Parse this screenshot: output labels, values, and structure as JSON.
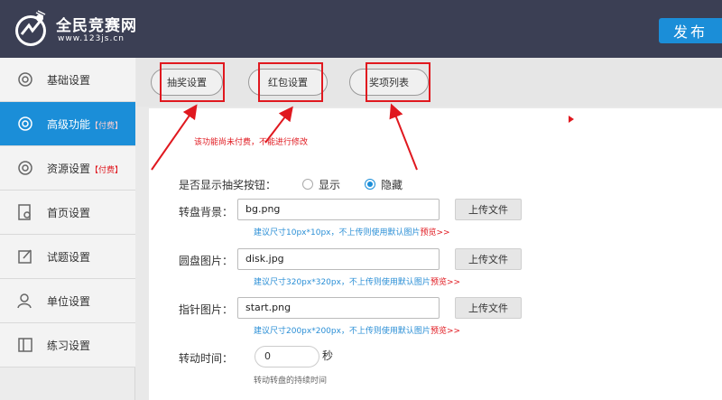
{
  "header": {
    "logo_title": "全民竞赛网",
    "logo_sub": "www.123js.cn",
    "publish_label": "发布"
  },
  "sidebar": {
    "items": [
      {
        "label": "基础设置",
        "badge": "",
        "icon": "gear-icon",
        "active": false
      },
      {
        "label": "高级功能",
        "badge": "【付费】",
        "icon": "gear-icon",
        "active": true
      },
      {
        "label": "资源设置",
        "badge": "【付费】",
        "icon": "gear-icon",
        "active": false
      },
      {
        "label": "首页设置",
        "badge": "",
        "icon": "document-search-icon",
        "active": false
      },
      {
        "label": "试题设置",
        "badge": "",
        "icon": "edit-icon",
        "active": false
      },
      {
        "label": "单位设置",
        "badge": "",
        "icon": "user-icon",
        "active": false
      },
      {
        "label": "练习设置",
        "badge": "",
        "icon": "book-icon",
        "active": false
      }
    ]
  },
  "tabs": [
    {
      "label": "抽奖设置"
    },
    {
      "label": "红包设置"
    },
    {
      "label": "奖项列表"
    }
  ],
  "notice": "该功能尚未付费，不能进行修改",
  "form": {
    "show_button_label": "是否显示抽奖按钮：",
    "radio_show": "显示",
    "radio_hide": "隐藏",
    "selected": "隐藏",
    "bg_label": "转盘背景：",
    "bg_value": "bg.png",
    "bg_hint": "建议尺寸10px*10px，不上传则使用默认图片",
    "disk_label": "圆盘图片：",
    "disk_value": "disk.jpg",
    "disk_hint": "建议尺寸320px*320px，不上传则使用默认图片",
    "pointer_label": "指针图片：",
    "pointer_value": "start.png",
    "pointer_hint": "建议尺寸200px*200px，不上传则使用默认图片",
    "preview_text": "预览>>",
    "upload_label": "上传文件",
    "duration_label": "转动时间：",
    "duration_value": "0",
    "duration_unit": "秒",
    "duration_hint": "转动转盘的持续时间"
  },
  "colors": {
    "accent": "#1b8ed8",
    "header_bg": "#3b3f54",
    "annotation_red": "#e0181f"
  }
}
